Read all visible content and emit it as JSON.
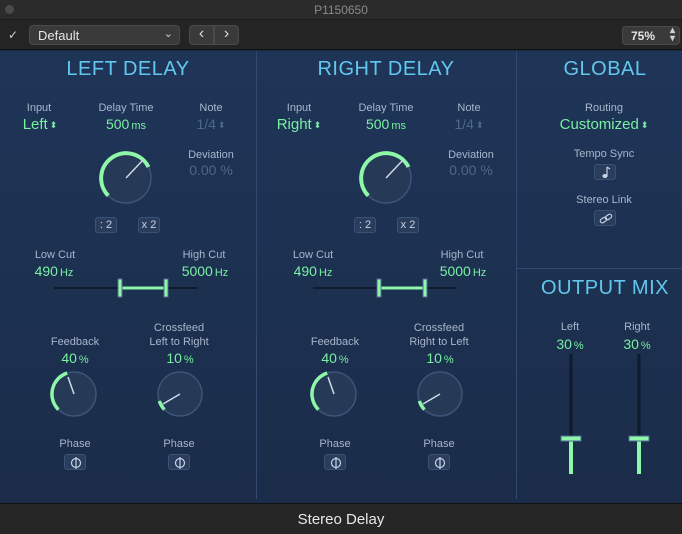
{
  "window": {
    "title": "P1150650"
  },
  "toolbar": {
    "enable_check": "✓",
    "preset": "Default",
    "prev": "‹",
    "next": "›",
    "zoom": "75%"
  },
  "left": {
    "title": "LEFT DELAY",
    "input_label": "Input",
    "input_value": "Left",
    "delay_label": "Delay Time",
    "delay_value": "500",
    "delay_unit": "ms",
    "note_label": "Note",
    "note_value": "1/4",
    "deviation_label": "Deviation",
    "deviation_value": "0.00 %",
    "div_btn": ": 2",
    "mul_btn": "x 2",
    "lowcut_label": "Low Cut",
    "lowcut_value": "490",
    "lowcut_unit": "Hz",
    "highcut_label": "High Cut",
    "highcut_value": "5000",
    "highcut_unit": "Hz",
    "feedback_label": "Feedback",
    "feedback_value": "40",
    "feedback_unit": "%",
    "crossfeed_label1": "Crossfeed",
    "crossfeed_label2": "Left to Right",
    "crossfeed_value": "10",
    "crossfeed_unit": "%",
    "phase1_label": "Phase",
    "phase2_label": "Phase"
  },
  "right": {
    "title": "RIGHT DELAY",
    "input_label": "Input",
    "input_value": "Right",
    "delay_label": "Delay Time",
    "delay_value": "500",
    "delay_unit": "ms",
    "note_label": "Note",
    "note_value": "1/4",
    "deviation_label": "Deviation",
    "deviation_value": "0.00 %",
    "div_btn": ": 2",
    "mul_btn": "x 2",
    "lowcut_label": "Low Cut",
    "lowcut_value": "490",
    "lowcut_unit": "Hz",
    "highcut_label": "High Cut",
    "highcut_value": "5000",
    "highcut_unit": "Hz",
    "feedback_label": "Feedback",
    "feedback_value": "40",
    "feedback_unit": "%",
    "crossfeed_label1": "Crossfeed",
    "crossfeed_label2": "Right to Left",
    "crossfeed_value": "10",
    "crossfeed_unit": "%",
    "phase1_label": "Phase",
    "phase2_label": "Phase"
  },
  "global": {
    "title": "GLOBAL",
    "routing_label": "Routing",
    "routing_value": "Customized",
    "tempo_label": "Tempo Sync",
    "stereo_label": "Stereo Link"
  },
  "output": {
    "title": "OUTPUT MIX",
    "left_label": "Left",
    "left_value": "30",
    "left_unit": "%",
    "right_label": "Right",
    "right_value": "30",
    "right_unit": "%"
  },
  "footer": {
    "plugin_name": "Stereo Delay"
  },
  "colors": {
    "accent": "#62c7ee",
    "value": "#79f0a2",
    "knob_arc": "#8ef7a8"
  }
}
